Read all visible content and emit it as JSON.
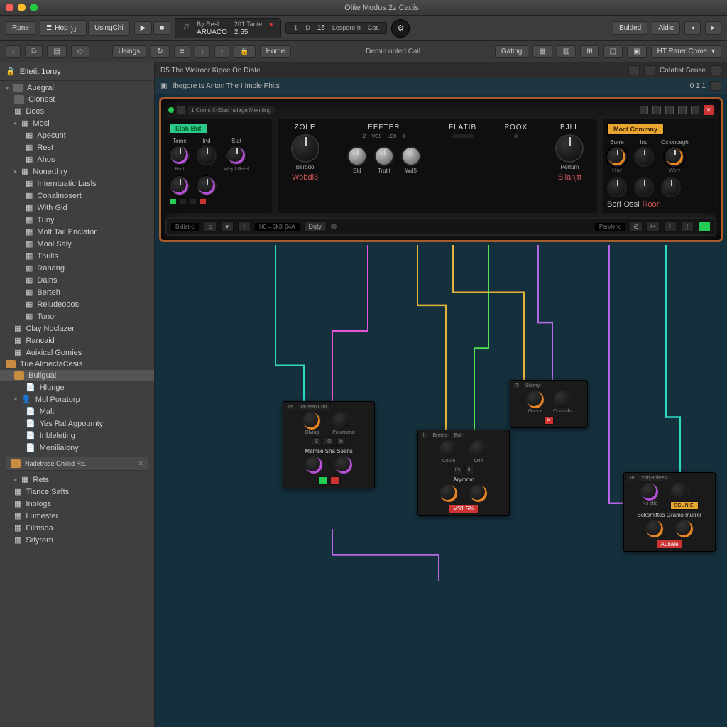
{
  "window": {
    "title": "Olite Modus 2z Cadis"
  },
  "toolbar": {
    "rone": "Rone",
    "hop": "Hop",
    "using": "UsingChi",
    "lcd1": {
      "a": "By Resl",
      "b": "ARUACO",
      "c": "201 Tante",
      "d": "2.55"
    },
    "lcd2": {
      "a": "16",
      "b": "Lespare h",
      "c": "Cat."
    },
    "right1": "Bulded",
    "right2": "Aidic"
  },
  "secbar": {
    "back": "‹",
    "usings": "Usings",
    "home": "Home",
    "breadcrumb": "Demin obted Cail",
    "gating": "Gating",
    "preset": "HT Rarer Come"
  },
  "sidebar": {
    "header": "Eltetit 1oroy",
    "sectionA": "Auegral",
    "items1": [
      "Clonest",
      "Does",
      "Mosl",
      "Apecunt",
      "Rest",
      "Ahos",
      "Nonerthry",
      "Interntuatic Lasls",
      "Conalmosert",
      "With Gid",
      "Tuny",
      "Molt Tail Enclator",
      "Mool Saly",
      "Thulls",
      "Ranang",
      "Dains",
      "Berteh",
      "Reludeodos",
      "Tonor"
    ],
    "items2": [
      "Clay Noclazer",
      "Rancaid",
      "Auixical Gomies"
    ],
    "sectionB": "Tue AlmectaCesis",
    "items3": [
      "Bullgual",
      "Hlunge",
      "Mul Poratorp",
      "Malt",
      "Yes Ral Agpoumty",
      "Inbleleting",
      "Menilialony"
    ],
    "chip": "Nadetrose Ghilod Re.",
    "items4": [
      "Rets",
      "Tiance Safts",
      "Inologs",
      "Lumester",
      "Filmsda",
      "Srlyrern"
    ]
  },
  "canvas": {
    "row1": "D5 The Walroor Kipee On Diate",
    "row1r": "Cotatist Seuse",
    "row2": "Ihegore ts Anton The I Imole Phits",
    "row2b": "0  1 1",
    "rackTag": "1 Coms © Elac nalage Mentting"
  },
  "rack": {
    "greenLabel": "Elah But",
    "goldLabel": "Moct Commny",
    "knobs1": [
      "Tome",
      "Ind",
      "Slat"
    ],
    "knobs1sub": [
      "Hort",
      "Wey  l·Retel"
    ],
    "sections": [
      "ZOLE",
      "EEFTER",
      "FLATIB",
      "POOX",
      "BJLL"
    ],
    "zoleSub": "Berodo",
    "zoleFoot": "Wobdl3",
    "eefter": [
      "Sld",
      "Trutlt",
      "Wd5"
    ],
    "eefterSub": [
      "2",
      "VO0",
      "LC0",
      "3"
    ],
    "bjll": "Pertum",
    "bjllFoot": "Bilanjtt",
    "right": [
      "Burre",
      "Ind",
      "Octoncegh"
    ],
    "rightSub": [
      "Hlay",
      "Wary"
    ],
    "rightFoot": [
      "Borl",
      "Ossl",
      "Roorl"
    ]
  },
  "tstrip": {
    "disp1": "Bldist-ci",
    "disp2": "H0 =  3k3l  04A",
    "mid": "Duty",
    "r": "Perylenc"
  },
  "nodes": {
    "n1": {
      "head": [
        "Its",
        "Mussto Cso"
      ],
      "labels": [
        "Olving",
        "Polorcand"
      ],
      "title": "Mamse Sha Seens",
      "btns": [
        "S",
        "IO",
        "Ib"
      ]
    },
    "n2": {
      "head": [
        "lt",
        "Breets",
        "Bol"
      ],
      "labels": [
        "Couln",
        "Olin"
      ],
      "btns": [
        "IO",
        "Ib"
      ],
      "title": "Arymom",
      "badge": "VS1.5%"
    },
    "n3": {
      "head": [
        "T",
        "Stomy"
      ],
      "labels": [
        "Gnoce",
        "Comtals"
      ]
    },
    "n4": {
      "head": [
        "Te",
        "Yob Bnitres"
      ],
      "labels": [
        "Ns atle"
      ],
      "title": "Sckomittes Grams Inurrer",
      "btn": "Aunale",
      "gold": "SGUN-EI"
    }
  }
}
